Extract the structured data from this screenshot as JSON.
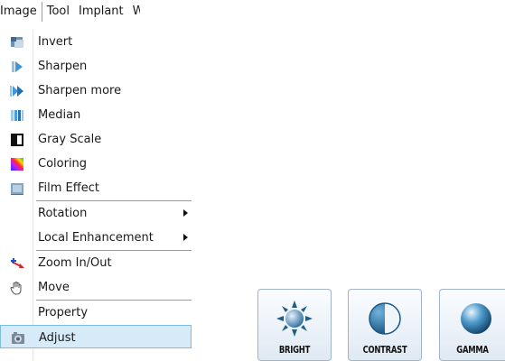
{
  "menubar": {
    "items": [
      {
        "label": "Image",
        "active": true
      },
      {
        "label": "Tool"
      },
      {
        "label": "Implant"
      },
      {
        "label": "W"
      }
    ]
  },
  "image_menu": {
    "items": [
      {
        "label": "Invert",
        "icon": "invert-icon"
      },
      {
        "label": "Sharpen",
        "icon": "sharpen-icon"
      },
      {
        "label": "Sharpen more",
        "icon": "sharpen-more-icon"
      },
      {
        "label": "Median",
        "icon": "median-icon"
      },
      {
        "label": "Gray Scale",
        "icon": "gray-scale-icon"
      },
      {
        "label": "Coloring",
        "icon": "coloring-icon"
      },
      {
        "label": "Film Effect",
        "icon": "film-effect-icon"
      },
      {
        "label": "Rotation",
        "submenu": true
      },
      {
        "label": "Local Enhancement",
        "submenu": true
      },
      {
        "label": "Zoom In/Out",
        "icon": "zoom-icon"
      },
      {
        "label": "Move",
        "icon": "hand-icon"
      },
      {
        "label": "Property"
      },
      {
        "label": "Adjust",
        "icon": "adjust-icon",
        "highlighted": true
      }
    ]
  },
  "adjust_buttons": [
    {
      "label": "BRIGHT",
      "icon": "sun-icon"
    },
    {
      "label": "CONTRAST",
      "icon": "contrast-icon"
    },
    {
      "label": "GAMMA",
      "icon": "gamma-sphere-icon"
    }
  ],
  "colors": {
    "highlight_bg": "#d6eaf7",
    "highlight_border": "#7dbce0",
    "button_border": "#9fb4c9"
  }
}
